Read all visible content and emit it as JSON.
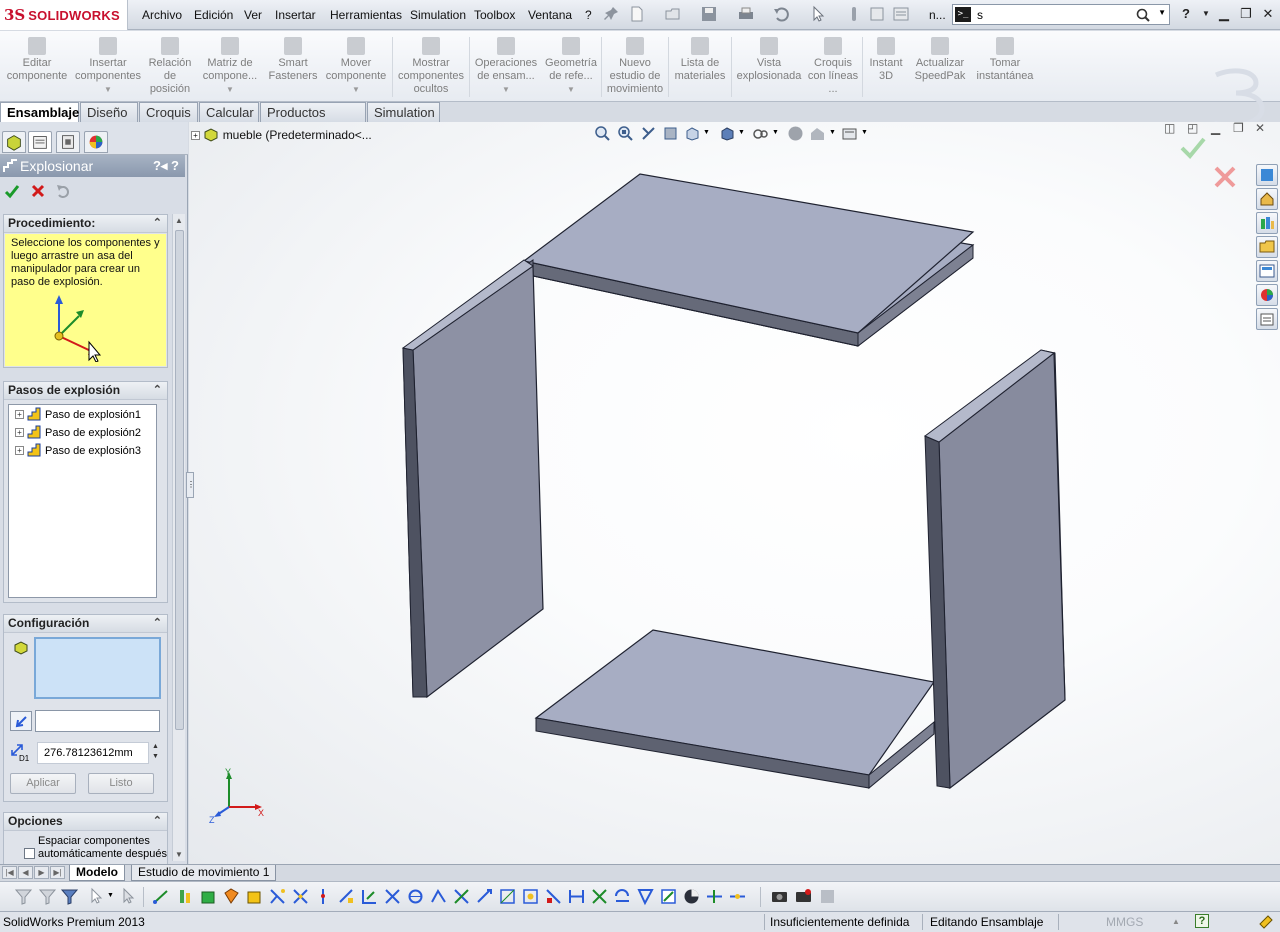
{
  "app": {
    "logo_mark": "3S",
    "logo_text": "SOLIDWORKS"
  },
  "menu": [
    "Archivo",
    "Edición",
    "Ver",
    "Insertar",
    "Herramientas",
    "Simulation",
    "Toolbox",
    "Ventana",
    "?"
  ],
  "quick_access": {
    "doc_title": "n...",
    "search_value": "s",
    "search_prompt_glyph": ">_",
    "help": "?"
  },
  "command_manager": [
    {
      "label": "Editar componente",
      "icon": "edit-component-icon"
    },
    {
      "label": "Insertar componentes",
      "icon": "insert-components-icon"
    },
    {
      "label": "Relación de posición",
      "icon": "mate-icon"
    },
    {
      "label": "Matriz de compone...",
      "icon": "component-pattern-icon"
    },
    {
      "label": "Smart Fasteners",
      "icon": "smart-fasteners-icon"
    },
    {
      "label": "Mover componente",
      "icon": "move-component-icon"
    },
    {
      "label": "Mostrar componentes ocultos",
      "icon": "show-hidden-icon"
    },
    {
      "label": "Operaciones de ensam...",
      "icon": "assembly-features-icon"
    },
    {
      "label": "Geometría de refe...",
      "icon": "reference-geometry-icon"
    },
    {
      "label": "Nuevo estudio de movimiento",
      "icon": "motion-study-icon"
    },
    {
      "label": "Lista de materiales",
      "icon": "bom-icon"
    },
    {
      "label": "Vista explosionada",
      "icon": "exploded-view-icon"
    },
    {
      "label": "Croquis con líneas ...",
      "icon": "explode-line-sketch-icon"
    },
    {
      "label": "Instant 3D",
      "icon": "instant-3d-icon"
    },
    {
      "label": "Actualizar SpeedPak",
      "icon": "speedpak-icon"
    },
    {
      "label": "Tomar instantánea",
      "icon": "snapshot-icon"
    }
  ],
  "tabs": [
    "Ensamblaje",
    "Diseño",
    "Croquis",
    "Calcular",
    "Productos Office",
    "Simulation"
  ],
  "property_manager": {
    "title": "Explosionar",
    "procedure": {
      "heading": "Procedimiento:",
      "message": "Seleccione los componentes y luego arrastre un asa del manipulador para crear un paso de explosión."
    },
    "steps": {
      "heading": "Pasos de explosión",
      "items": [
        "Paso de explosión1",
        "Paso de explosión2",
        "Paso de explosión3"
      ]
    },
    "configuration": {
      "heading": "Configuración",
      "direction_value": "",
      "distance_value": "276.78123612mm",
      "distance_tag": "D1",
      "apply_label": "Aplicar",
      "done_label": "Listo"
    },
    "options": {
      "heading": "Opciones",
      "auto_space_label": "Espaciar componentes automáticamente después"
    }
  },
  "graphics": {
    "tree_root": "mueble  (Predeterminado<...",
    "triad": {
      "x": "X",
      "y": "Y",
      "z": "Z"
    }
  },
  "bottom_tabs": [
    "Modelo",
    "Estudio de movimiento 1"
  ],
  "status": {
    "product": "SolidWorks Premium 2013",
    "definition": "Insuficientemente definida",
    "mode": "Editando Ensamblaje",
    "units": "MMGS",
    "help": "?"
  },
  "colors": {
    "panel_face": "#a9aec0",
    "panel_edge": "#5c6170",
    "message_bg": "#ffff8c",
    "brand_red": "#c8102e"
  }
}
